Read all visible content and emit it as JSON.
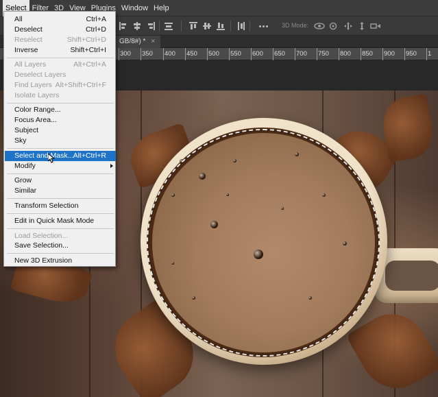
{
  "menubar": {
    "items": [
      "Select",
      "Filter",
      "3D",
      "View",
      "Plugins",
      "Window",
      "Help"
    ],
    "active": "Select"
  },
  "optionsbar": {
    "mode_label": "3D Mode:"
  },
  "tab": {
    "title": "GB/8#) *",
    "close": "×"
  },
  "ruler": {
    "ticks": [
      "300",
      "350",
      "400",
      "450",
      "500",
      "550",
      "600",
      "650",
      "700",
      "750",
      "800",
      "850",
      "900",
      "950",
      "1"
    ]
  },
  "select_menu": {
    "items": [
      {
        "label": "All",
        "shortcut": "Ctrl+A",
        "enabled": true
      },
      {
        "label": "Deselect",
        "shortcut": "Ctrl+D",
        "enabled": true
      },
      {
        "label": "Reselect",
        "shortcut": "Shift+Ctrl+D",
        "enabled": false
      },
      {
        "label": "Inverse",
        "shortcut": "Shift+Ctrl+I",
        "enabled": true
      },
      {
        "label": "All Layers",
        "shortcut": "Alt+Ctrl+A",
        "enabled": false
      },
      {
        "label": "Deselect Layers",
        "shortcut": "",
        "enabled": false
      },
      {
        "label": "Find Layers",
        "shortcut": "Alt+Shift+Ctrl+F",
        "enabled": false
      },
      {
        "label": "Isolate Layers",
        "shortcut": "",
        "enabled": false
      },
      {
        "label": "Color Range...",
        "shortcut": "",
        "enabled": true
      },
      {
        "label": "Focus Area...",
        "shortcut": "",
        "enabled": true
      },
      {
        "label": "Subject",
        "shortcut": "",
        "enabled": true
      },
      {
        "label": "Sky",
        "shortcut": "",
        "enabled": true
      },
      {
        "label": "Select and Mask...",
        "shortcut": "Alt+Ctrl+R",
        "enabled": true,
        "highlighted": true
      },
      {
        "label": "Modify",
        "shortcut": "",
        "enabled": true,
        "submenu": true
      },
      {
        "label": "Grow",
        "shortcut": "",
        "enabled": true
      },
      {
        "label": "Similar",
        "shortcut": "",
        "enabled": true
      },
      {
        "label": "Transform Selection",
        "shortcut": "",
        "enabled": true
      },
      {
        "label": "Edit in Quick Mask Mode",
        "shortcut": "",
        "enabled": true
      },
      {
        "label": "Load Selection...",
        "shortcut": "",
        "enabled": false
      },
      {
        "label": "Save Selection...",
        "shortcut": "",
        "enabled": true
      },
      {
        "label": "New 3D Extrusion",
        "shortcut": "",
        "enabled": true
      }
    ]
  },
  "colors": {
    "highlight": "#1e73c8",
    "menu_bg": "#f0f0f0",
    "disabled_text": "#9a9a9a"
  }
}
